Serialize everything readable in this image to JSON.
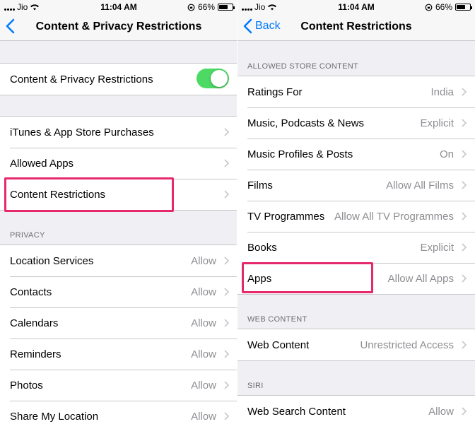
{
  "status": {
    "carrier": "Jio",
    "time": "11:04 AM",
    "battery": "66%",
    "battery_level": 0.66
  },
  "left": {
    "nav_title": "Content & Privacy Restrictions",
    "toggle_row": {
      "label": "Content & Privacy Restrictions",
      "on": true
    },
    "items": [
      {
        "label": "iTunes & App Store Purchases"
      },
      {
        "label": "Allowed Apps"
      },
      {
        "label": "Content Restrictions"
      }
    ],
    "privacy_header": "PRIVACY",
    "privacy_items": [
      {
        "label": "Location Services",
        "value": "Allow"
      },
      {
        "label": "Contacts",
        "value": "Allow"
      },
      {
        "label": "Calendars",
        "value": "Allow"
      },
      {
        "label": "Reminders",
        "value": "Allow"
      },
      {
        "label": "Photos",
        "value": "Allow"
      },
      {
        "label": "Share My Location",
        "value": "Allow"
      }
    ]
  },
  "right": {
    "back_label": "Back",
    "nav_title": "Content Restrictions",
    "store_header": "ALLOWED STORE CONTENT",
    "store_items": [
      {
        "label": "Ratings For",
        "value": "India"
      },
      {
        "label": "Music, Podcasts & News",
        "value": "Explicit"
      },
      {
        "label": "Music Profiles & Posts",
        "value": "On"
      },
      {
        "label": "Films",
        "value": "Allow All Films"
      },
      {
        "label": "TV Programmes",
        "value": "Allow All TV Programmes"
      },
      {
        "label": "Books",
        "value": "Explicit"
      },
      {
        "label": "Apps",
        "value": "Allow All Apps"
      }
    ],
    "web_header": "WEB CONTENT",
    "web_items": [
      {
        "label": "Web Content",
        "value": "Unrestricted Access"
      }
    ],
    "siri_header": "SIRI",
    "siri_items": [
      {
        "label": "Web Search Content",
        "value": "Allow"
      }
    ]
  },
  "colors": {
    "accent": "#007aff",
    "toggle_on": "#4cd964",
    "highlight": "#e6286d",
    "secondary_text": "#8e8e93"
  }
}
